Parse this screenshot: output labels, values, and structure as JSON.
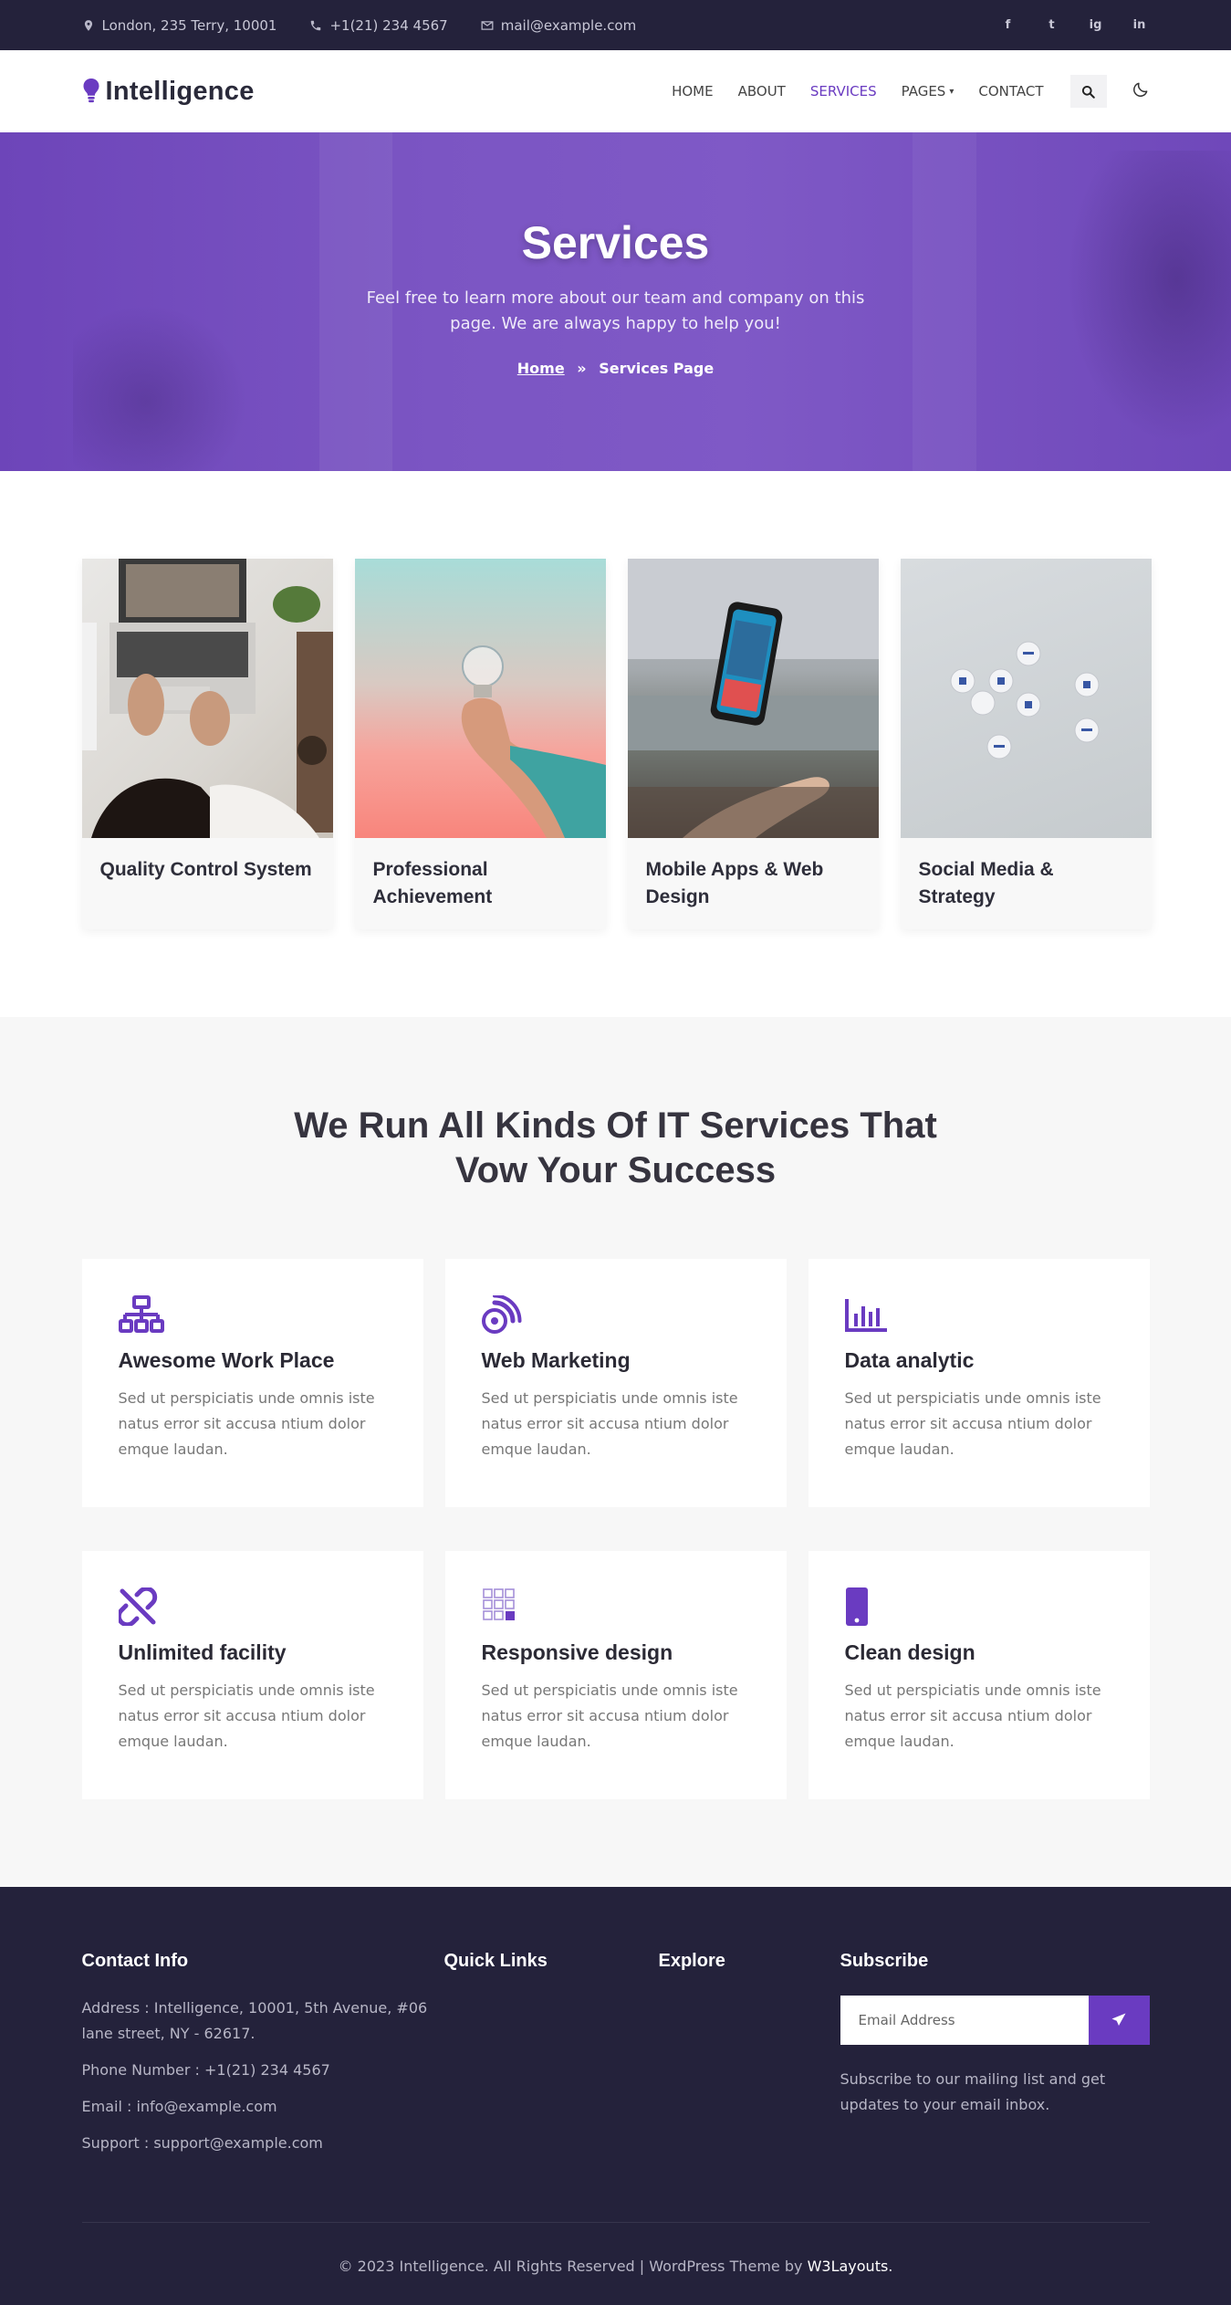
{
  "topbar": {
    "address": "London, 235 Terry, 10001",
    "phone": "+1(21) 234 4567",
    "email": "mail@example.com",
    "social": [
      "f",
      "t",
      "ig",
      "in"
    ]
  },
  "header": {
    "logo": "Intelligence",
    "nav": [
      {
        "label": "HOME"
      },
      {
        "label": "ABOUT"
      },
      {
        "label": "SERVICES"
      },
      {
        "label": "PAGES"
      },
      {
        "label": "CONTACT"
      }
    ]
  },
  "hero": {
    "title": "Services",
    "subtitle": "Feel free to learn more about our team and company on this page. We are always happy to help you!",
    "breadcrumb_home": "Home",
    "breadcrumb_sep": "»",
    "breadcrumb_current": "Services Page"
  },
  "cards": [
    {
      "title": "Quality Control System"
    },
    {
      "title": "Professional Achievement"
    },
    {
      "title": "Mobile Apps & Web Design"
    },
    {
      "title": "Social Media & Strategy"
    }
  ],
  "services": {
    "heading": "We Run All Kinds Of IT Services That Vow Your Success",
    "items": [
      {
        "title": "Awesome Work Place",
        "text": "Sed ut perspiciatis unde omnis iste natus error sit accusa ntium dolor emque laudan.",
        "icon": "sitemap-icon"
      },
      {
        "title": "Web Marketing",
        "text": "Sed ut perspiciatis unde omnis iste natus error sit accusa ntium dolor emque laudan.",
        "icon": "rss-icon"
      },
      {
        "title": "Data analytic",
        "text": "Sed ut perspiciatis unde omnis iste natus error sit accusa ntium dolor emque laudan.",
        "icon": "bar-chart-icon"
      },
      {
        "title": "Unlimited facility",
        "text": "Sed ut perspiciatis unde omnis iste natus error sit accusa ntium dolor emque laudan.",
        "icon": "broken-link-icon"
      },
      {
        "title": "Responsive design",
        "text": "Sed ut perspiciatis unde omnis iste natus error sit accusa ntium dolor emque laudan.",
        "icon": "grid-icon"
      },
      {
        "title": "Clean design",
        "text": "Sed ut perspiciatis unde omnis iste natus error sit accusa ntium dolor emque laudan.",
        "icon": "mobile-icon"
      }
    ]
  },
  "footer": {
    "contact_heading": "Contact Info",
    "address": "Address : Intelligence, 10001, 5th Avenue, #06 lane street, NY - 62617.",
    "phone": "Phone Number : +1(21) 234 4567",
    "email": "Email : info@example.com",
    "support": "Support : support@example.com",
    "quick_links_heading": "Quick Links",
    "explore_heading": "Explore",
    "subscribe_heading": "Subscribe",
    "subscribe_placeholder": "Email Address",
    "subscribe_text": "Subscribe to our mailing list and get updates to your email inbox.",
    "copyright": "© 2023 Intelligence. All Rights Reserved | WordPress Theme by",
    "copyright_brand": "W3Layouts."
  },
  "colors": {
    "accent": "#6a3bc1",
    "dark": "#24223b"
  }
}
